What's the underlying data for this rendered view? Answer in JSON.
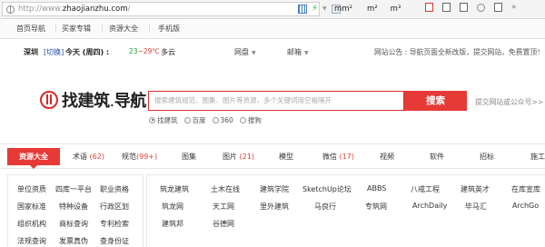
{
  "browser": {
    "url_prefix": "http://www.",
    "url_domain": "zhaojianzhu.com",
    "url_suffix": "/",
    "units": [
      "mm²",
      "m²",
      "m³"
    ]
  },
  "topnav": [
    "首页导航",
    "买家专辑",
    "资源大全",
    "手机版"
  ],
  "infobar": {
    "city": "深圳",
    "city_switch": "[切换]",
    "today": "今天 (周四) :",
    "temp_low": "23",
    "temp_sep": "~",
    "temp_high": "29℃",
    "weather": "多云",
    "links": [
      "网盘",
      "邮箱"
    ],
    "notice": "网站公告 : 导航页面全新改版，提交网站，免费置顶！"
  },
  "hero": {
    "logo_main": "找建筑",
    "logo_dot": ".",
    "logo_sub": "导航",
    "search_placeholder": "搜索建筑规范、图集、图片等资源，多个关键词用空格隔开",
    "search_button": "搜索",
    "submit_link": "提交网站或公众号>>",
    "engines": [
      {
        "label": "找建筑",
        "selected": true
      },
      {
        "label": "百度",
        "selected": false
      },
      {
        "label": "360",
        "selected": false
      },
      {
        "label": "搜狗",
        "selected": false
      }
    ]
  },
  "categories": {
    "active": "资源大全",
    "items": [
      {
        "label": "术语",
        "count": "(62)"
      },
      {
        "label": "规范",
        "count": "(99+)"
      },
      {
        "label": "图集",
        "count": ""
      },
      {
        "label": "图片",
        "count": "(21)"
      },
      {
        "label": "模型",
        "count": ""
      },
      {
        "label": "微信",
        "count": "(17)"
      },
      {
        "label": "视频",
        "count": ""
      },
      {
        "label": "软件",
        "count": ""
      },
      {
        "label": "招标",
        "count": ""
      },
      {
        "label": "施工",
        "count": ""
      }
    ]
  },
  "resources": [
    [
      "单位资质",
      "四库一平台",
      "职业资格"
    ],
    [
      "国家标准",
      "特种设备",
      "行政区划"
    ],
    [
      "组织机构",
      "商标查询",
      "专利检索"
    ],
    [
      "法规查询",
      "发票真伪",
      "查身份证"
    ]
  ],
  "sites": [
    [
      "筑龙建筑",
      "土木在线",
      "建筑学院",
      "SketchUp论坛",
      "ABBS",
      "八戒工程",
      "建筑英才",
      "在库宣库"
    ],
    [
      "筑龙网",
      "天工网",
      "里外建筑",
      "马良行",
      "专筑网",
      "ArchDaily",
      "毕马汇",
      "ArchGo"
    ],
    [
      "建筑邦",
      "谷德网"
    ]
  ]
}
